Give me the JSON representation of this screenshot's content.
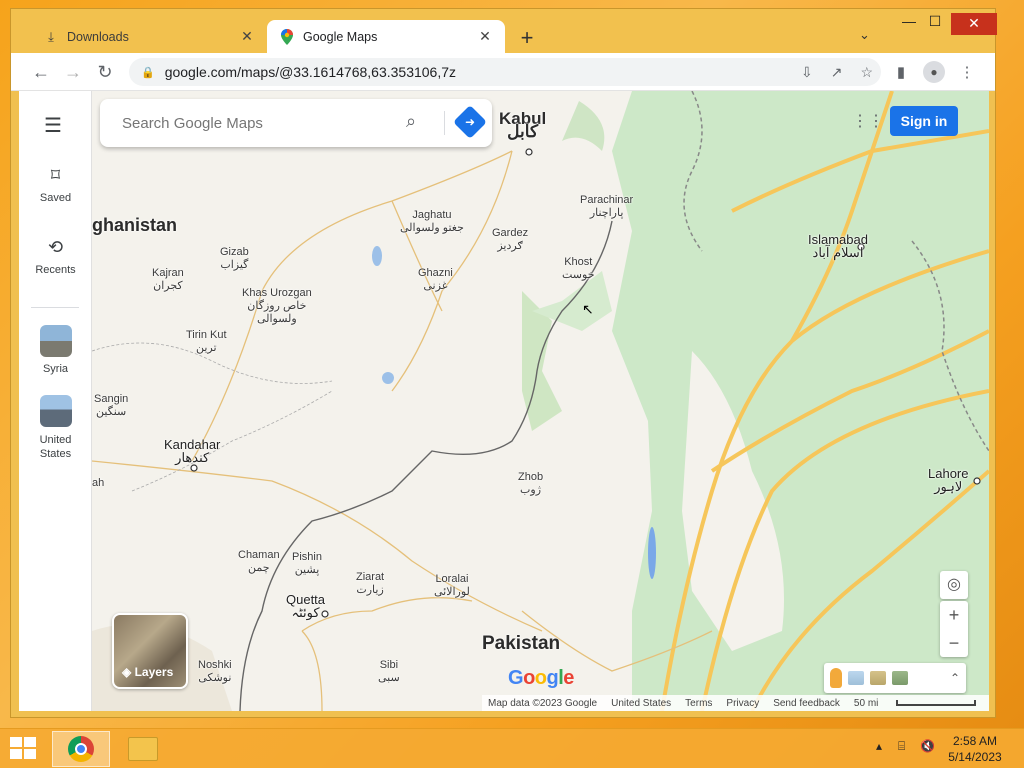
{
  "browser": {
    "tabs": [
      {
        "label": "Downloads",
        "icon": "download-icon",
        "active": false
      },
      {
        "label": "Google Maps",
        "icon": "maps-pin-icon",
        "active": true
      }
    ],
    "url": "google.com/maps/@33.1614768,63.353106,7z",
    "window_controls": {
      "minimize": "—",
      "maximize": "☐",
      "close": "✕"
    }
  },
  "sidebar": {
    "items": [
      {
        "label": "Saved",
        "icon": "bookmark-icon"
      },
      {
        "label": "Recents",
        "icon": "history-icon"
      },
      {
        "label": "Syria",
        "icon": "syria-thumbnail"
      },
      {
        "label": "United States",
        "icon": "united-states-thumbnail"
      }
    ]
  },
  "search": {
    "placeholder": "Search Google Maps"
  },
  "header": {
    "sign_in": "Sign in"
  },
  "layers": {
    "label": "Layers"
  },
  "map": {
    "labels": [
      {
        "id": "kabul",
        "text": "Kabul\nکابل"
      },
      {
        "id": "afghanistan",
        "text": "ghanistan"
      },
      {
        "id": "parachinar",
        "text": "Parachinar\nپاراچنار"
      },
      {
        "id": "jaghatu",
        "text": "Jaghatu\nجغتو ولسوالی"
      },
      {
        "id": "gardez",
        "text": "Gardez\nګرديز"
      },
      {
        "id": "gizab",
        "text": "Gizab\nگیزاب"
      },
      {
        "id": "khost",
        "text": "Khost\nخوست"
      },
      {
        "id": "islamabad",
        "text": "Islamabad\nاسلام آباد"
      },
      {
        "id": "kajran",
        "text": "Kajran\nکجران"
      },
      {
        "id": "khas-urozgan",
        "text": "Khas Urozgan\nخاص روزگان\nولسوالی"
      },
      {
        "id": "ghazni",
        "text": "Ghazni\nغزنی"
      },
      {
        "id": "tirin-kut",
        "text": "Tirin Kut\nترین"
      },
      {
        "id": "sangin",
        "text": "Sangin\nسنگین"
      },
      {
        "id": "kandahar",
        "text": "Kandahar\nکندهار"
      },
      {
        "id": "zhob",
        "text": "Zhob\nژوب"
      },
      {
        "id": "lahore",
        "text": "Lahore\nلاہور"
      },
      {
        "id": "ah",
        "text": "ah"
      },
      {
        "id": "chaman",
        "text": "Chaman\nچمن"
      },
      {
        "id": "pishin",
        "text": "Pishin\nپشین"
      },
      {
        "id": "ziarat",
        "text": "Ziarat\nزیارت"
      },
      {
        "id": "loralai",
        "text": "Loralai\nلورالائی"
      },
      {
        "id": "quetta",
        "text": "Quetta\nکوئٹہ"
      },
      {
        "id": "pakistan",
        "text": "Pakistan"
      },
      {
        "id": "noshki",
        "text": "Noshki\nنوشکی"
      },
      {
        "id": "sibi",
        "text": "Sibi\nسبی"
      }
    ]
  },
  "branding": {
    "google": "Google"
  },
  "footer": {
    "map_data": "Map data ©2023 Google",
    "region": "United States",
    "terms": "Terms",
    "privacy": "Privacy",
    "feedback": "Send feedback",
    "scale": "50 mi"
  },
  "taskbar": {
    "time": "2:58 AM",
    "date": "5/14/2023"
  }
}
